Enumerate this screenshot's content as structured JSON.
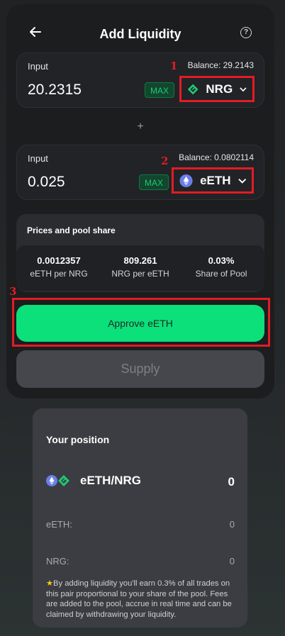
{
  "header": {
    "title": "Add Liquidity",
    "help_icon_text": "?"
  },
  "input_a": {
    "label": "Input",
    "balance": "Balance: 29.2143",
    "amount": "20.2315",
    "max_label": "MAX",
    "token": "NRG",
    "annotation": "1"
  },
  "plus": "+",
  "input_b": {
    "label": "Input",
    "balance": "Balance: 0.0802114",
    "amount": "0.025",
    "max_label": "MAX",
    "token": "eETH",
    "annotation": "2"
  },
  "pool": {
    "title": "Prices and pool share",
    "stats": [
      {
        "value": "0.0012357",
        "label": "eETH per NRG"
      },
      {
        "value": "809.261",
        "label": "NRG per eETH"
      },
      {
        "value": "0.03%",
        "label": "Share of Pool"
      }
    ]
  },
  "approve": {
    "label": "Approve eETH",
    "annotation": "3"
  },
  "supply": {
    "label": "Supply"
  },
  "position": {
    "title": "Your position",
    "pair": "eETH/NRG",
    "pair_value": "0",
    "rows": [
      {
        "label": "eETH:",
        "value": "0"
      },
      {
        "label": "NRG:",
        "value": "0"
      }
    ],
    "note": "By adding liquidity you'll earn 0.3% of all trades on this pair proportional to your share of the pool. Fees are added to the pool, accrue in real time and can be claimed by withdrawing your liquidity."
  },
  "colors": {
    "accent": "#0be07a",
    "annotation_red": "#e21c25",
    "nrg_green": "#21c779",
    "eth_blue": "#6b7fe8"
  }
}
